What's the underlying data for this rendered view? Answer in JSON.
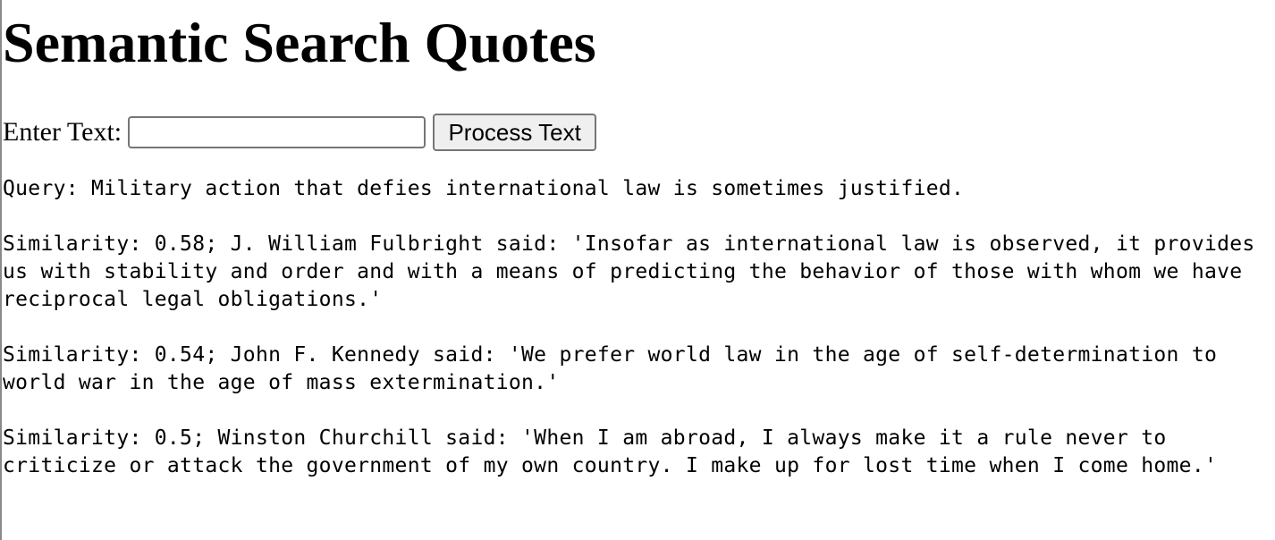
{
  "page": {
    "title": "Semantic Search Quotes"
  },
  "form": {
    "label": "Enter Text:",
    "input_value": "",
    "button_label": "Process Text"
  },
  "query": {
    "text": "Query: Military action that defies international law is sometimes justified."
  },
  "results": [
    {
      "lines": [
        "Similarity: 0.58; J. William Fulbright said: 'Insofar as international law is observed, it provides",
        "us with stability and order and with a means of predicting the behavior of those with whom we have",
        "reciprocal legal obligations.'"
      ]
    },
    {
      "lines": [
        "Similarity: 0.54; John F. Kennedy said: 'We prefer world law in the age of self-determination to",
        "world war in the age of mass extermination.'"
      ]
    },
    {
      "lines": [
        "Similarity: 0.5; Winston Churchill said: 'When I am abroad, I always make it a rule never to",
        "criticize or attack the government of my own country. I make up for lost time when I come home.'"
      ]
    }
  ]
}
